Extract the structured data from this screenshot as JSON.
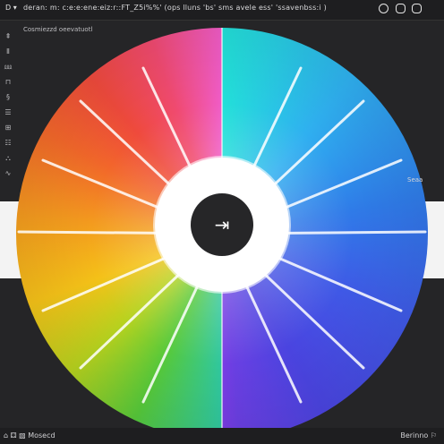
{
  "titlebar": {
    "app_tag": "D  ▾",
    "title": "deran: m: c:e:e:ene:eiz:r::FT_Z5i%%' (ops lluns 'bs' sms avele ess' 'ssavenbss:i )",
    "window_controls": [
      "record-icon",
      "minimize-icon",
      "close-icon"
    ]
  },
  "subbar": {
    "text": "Cosmiezzd   oeevatuotl"
  },
  "left_toolbar": {
    "items": [
      "⇞",
      "Ⅱ",
      "⅏",
      "⊓",
      "§",
      "☰",
      "⊞",
      "☷",
      "⛬",
      "∿"
    ]
  },
  "hub": {
    "button_glyph": "⇥",
    "icon": "arrow-right-icon"
  },
  "right_tool": {
    "label": "Seaa"
  },
  "statusbar": {
    "left": "⌂  ⚃  ▧  Mosecd",
    "right": "Berinno ⚐"
  },
  "colors": {
    "background": "#252527",
    "band": "#f3f3f3",
    "hub": "#ffffff",
    "hub_button": "#262628"
  }
}
